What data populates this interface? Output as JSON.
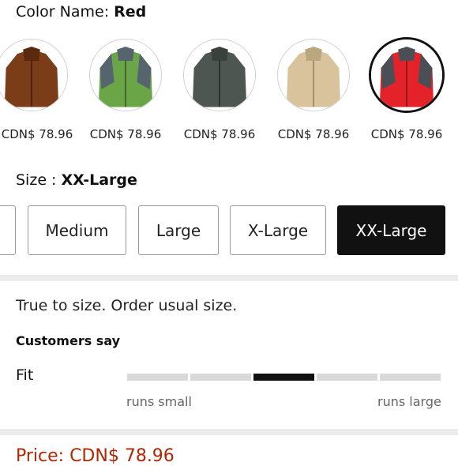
{
  "color": {
    "title_prefix": "Color Name: ",
    "selected_name": "Red",
    "options": [
      {
        "price": "CDN$ 78.96",
        "body_color": "#7a3d18",
        "accent_color": "#5a2a0e"
      },
      {
        "price": "CDN$ 78.96",
        "body_color": "#6aa648",
        "accent_color": "#566470"
      },
      {
        "price": "CDN$ 78.96",
        "body_color": "#4d5650",
        "accent_color": "#3a403c"
      },
      {
        "price": "CDN$ 78.96",
        "body_color": "#d8c39c",
        "accent_color": "#bba77f"
      },
      {
        "price": "CDN$ 78.96",
        "body_color": "#e3222a",
        "accent_color": "#4a4f56"
      }
    ]
  },
  "size": {
    "title_prefix": "Size : ",
    "selected": "XX-Large",
    "options": [
      "",
      "Medium",
      "Large",
      "X-Large",
      "XX-Large"
    ]
  },
  "fit": {
    "note": "True to size. Order usual size.",
    "customers_say": "Customers say",
    "label": "Fit",
    "segments": 5,
    "active_segment": 3,
    "left_label": "runs small",
    "right_label": "runs large"
  },
  "price_line": "Price: CDN$ 78.96",
  "colors": {
    "price_red": "#b12704",
    "selected_bg": "#111111"
  }
}
